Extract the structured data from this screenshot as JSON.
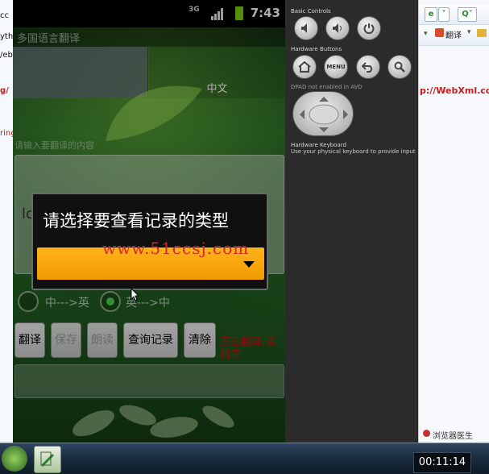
{
  "background_browser": {
    "left_fragments": [
      "cc",
      "yth",
      "/eb",
      "g/",
      "ring"
    ],
    "right_url_text": "p://WebXml.co",
    "right_translate_label": "翻译",
    "right_doctor_label": "浏览器医生"
  },
  "emulator": {
    "status_bar": {
      "time": "7:43",
      "network": "3G"
    },
    "app": {
      "title": "多国语言翻译",
      "tabs": [
        {
          "label": ""
        },
        {
          "label": "中文"
        }
      ],
      "input_hint": "请输入要翻译的内容",
      "input_text": "lc",
      "radio_options": [
        {
          "label": "中--->英",
          "checked": false
        },
        {
          "label": "英--->中",
          "checked": true
        }
      ],
      "buttons": {
        "translate": "翻译",
        "save": "保存",
        "read": "朗读",
        "query": "查询记录",
        "clear": "清除"
      },
      "status_message": "正在翻译,请稍等"
    },
    "dialog": {
      "title": "请选择要查看记录的类型",
      "spinner_value": ""
    },
    "watermark": "www.51ccsj.com",
    "controls": {
      "basic_heading": "Basic Controls",
      "hardware_heading": "Hardware Buttons",
      "menu_label": "MENU",
      "dpad_heading": "DPAD not enabled in AVD",
      "keyboard_heading": "Hardware Keyboard",
      "keyboard_sub": "Use your physical keyboard to provide input"
    }
  },
  "taskbar": {
    "clock": "00:11:14"
  },
  "colors": {
    "spinner": "#f7a10a",
    "status_red": "#ce1111",
    "taskbar": "#1c2d41"
  }
}
